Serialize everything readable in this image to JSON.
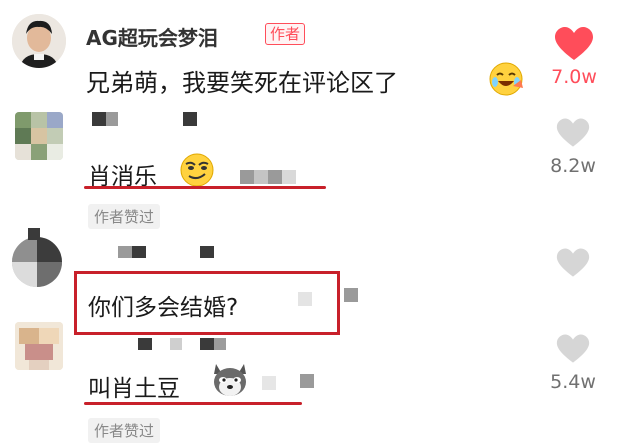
{
  "top_comment": {
    "username": "AG超玩会梦泪",
    "badge": "作者",
    "text": "兄弟萌，我要笑死在评论区了",
    "likes": "7.0w",
    "liked": true,
    "emoji_icon": "laughing-crying-emoji-icon"
  },
  "replies": [
    {
      "text": "肖消乐",
      "likes": "8.2w",
      "author_liked": "作者赞过",
      "emoji_icon": "smirk-emoji-icon"
    },
    {
      "text": "你们多会结婚?",
      "likes": "",
      "author_liked": ""
    },
    {
      "text": "叫肖土豆",
      "likes": "5.4w",
      "author_liked": "作者赞过",
      "emoji_icon": "husky-dog-emoji-icon"
    }
  ],
  "colors": {
    "accent_red": "#ff4d5a",
    "annotation_red": "#c8202a",
    "muted": "#707070"
  }
}
